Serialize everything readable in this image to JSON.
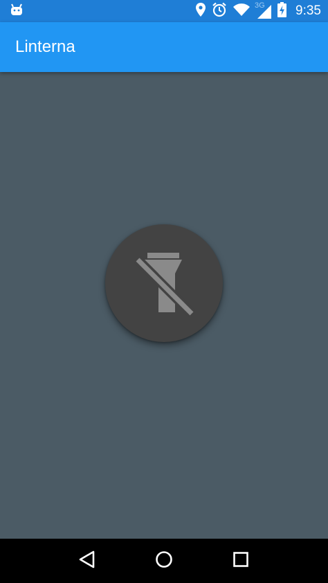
{
  "status_bar": {
    "time": "9:35",
    "network_type": "3G",
    "icons": [
      "android-debug-icon",
      "location-icon",
      "alarm-icon",
      "wifi-icon",
      "cell-signal-icon",
      "battery-charging-icon"
    ]
  },
  "app_bar": {
    "title": "Linterna"
  },
  "torch": {
    "state": "off",
    "icon": "flashlight-off-icon"
  },
  "nav_bar": {
    "buttons": [
      "back-icon",
      "home-icon",
      "recents-icon"
    ]
  },
  "colors": {
    "status_bar": "#1f7ed6",
    "app_bar": "#2196f3",
    "background": "#4b5b65",
    "torch_button": "#434343",
    "torch_icon": "#8a8a8a"
  }
}
